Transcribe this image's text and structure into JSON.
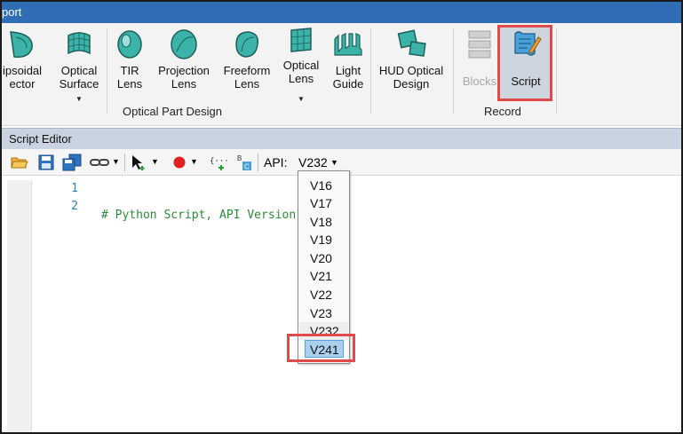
{
  "window": {
    "title_fragment": "port"
  },
  "ribbon": {
    "buttons": {
      "ellipsoidal": "ipsoidal\nector",
      "optical_surface": "Optical\nSurface",
      "tir_lens": "TIR\nLens",
      "projection_lens": "Projection\nLens",
      "freeform_lens": "Freeform\nLens",
      "optical_lens": "Optical\nLens",
      "light_guide": "Light\nGuide",
      "hud_optical_design": "HUD Optical\nDesign",
      "blocks": "Blocks",
      "script": "Script"
    },
    "groups": {
      "optical_part_design": "Optical Part Design",
      "record": "Record"
    }
  },
  "script_editor": {
    "title": "Script Editor",
    "api_label": "API:",
    "api_value": "V232",
    "line_numbers": [
      "1",
      "2"
    ],
    "code_lines": [
      "# Python Script, API Version = V232",
      ""
    ]
  },
  "api_dropdown": {
    "options": [
      "V16",
      "V17",
      "V18",
      "V19",
      "V20",
      "V21",
      "V22",
      "V23",
      "V232",
      "V241"
    ],
    "current": "V232",
    "selected": "V241"
  },
  "colors": {
    "titlebar": "#2f6eb5",
    "highlight_box": "#e04a4a",
    "selected_option": "#a9d1ef",
    "comment_text": "#2d8a3a",
    "line_number": "#2b7fb5"
  }
}
